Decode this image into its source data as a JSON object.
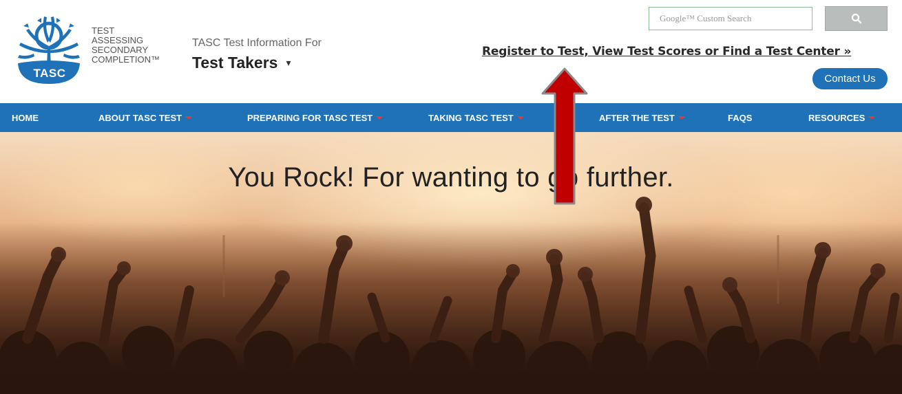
{
  "logo": {
    "badge": "TASC",
    "lines": [
      "TEST",
      "ASSESSING",
      "SECONDARY",
      "COMPLETION™"
    ]
  },
  "header": {
    "info_for": "TASC Test Information For",
    "audience": "Test Takers",
    "audience_caret": "▾",
    "search_placeholder": "Google™ Custom Search",
    "search_icon": "search-icon",
    "register_link": "Register to Test, View Test Scores or Find a Test Center »",
    "contact_label": "Contact Us"
  },
  "nav": {
    "items": [
      {
        "label": "HOME",
        "dropdown": false
      },
      {
        "label": "ABOUT TASC TEST",
        "dropdown": true
      },
      {
        "label": "PREPARING FOR TASC TEST",
        "dropdown": true
      },
      {
        "label": "TAKING TASC TEST",
        "dropdown": true
      },
      {
        "label": "AFTER THE TEST",
        "dropdown": true
      },
      {
        "label": "FAQs",
        "dropdown": false
      },
      {
        "label": "RESOURCES",
        "dropdown": true
      }
    ]
  },
  "hero": {
    "title": "You Rock! For wanting to go further."
  },
  "colors": {
    "brand_blue": "#1f72b8",
    "caret_red": "#e03c31",
    "arrow_red": "#c00000"
  }
}
